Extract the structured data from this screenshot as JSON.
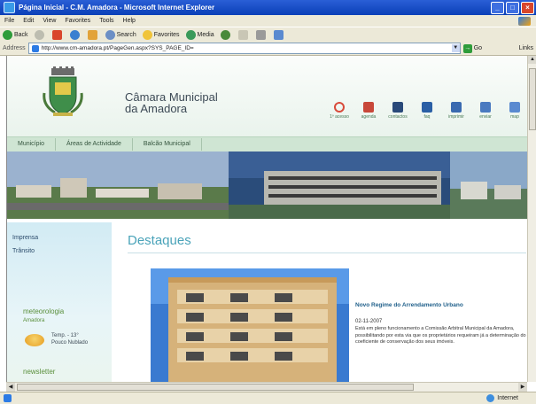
{
  "window": {
    "title": "Página Inicial - C.M. Amadora - Microsoft Internet Explorer",
    "minimize_label": "_",
    "maximize_label": "□",
    "close_label": "×"
  },
  "menubar": {
    "items": [
      "File",
      "Edit",
      "View",
      "Favorites",
      "Tools",
      "Help"
    ]
  },
  "toolbar": {
    "back_label": "Back",
    "search_label": "Search",
    "favorites_label": "Favorites",
    "media_label": "Media"
  },
  "address": {
    "label": "Address",
    "url": "http://www.cm-amadora.pt/PageGen.aspx?SYS_PAGE_ID=",
    "go_label": "Go",
    "links_label": "Links"
  },
  "site": {
    "brand_line1": "Câmara Municipal",
    "brand_line2": "da Amadora",
    "quick_links": [
      {
        "label": "1º acesso",
        "icon": "first-access-icon",
        "color": "#d84a3a"
      },
      {
        "label": "agenda",
        "icon": "agenda-icon",
        "color": "#c8483a"
      },
      {
        "label": "contactos",
        "icon": "contacts-icon",
        "color": "#2a4a7a"
      },
      {
        "label": "faq",
        "icon": "faq-icon",
        "color": "#2a5fa5"
      },
      {
        "label": "imprimir",
        "icon": "print-icon",
        "color": "#3a6ab0"
      },
      {
        "label": "enviar",
        "icon": "send-icon",
        "color": "#4a7ac0"
      },
      {
        "label": "map",
        "icon": "map-icon",
        "color": "#5a8ad0"
      }
    ],
    "nav": [
      "Município",
      "Áreas de Actividade",
      "Balcão Municipal"
    ],
    "sidebar_links": [
      "Imprensa",
      "Trânsito"
    ],
    "meteo": {
      "title": "meteorologia",
      "place": "Amadora",
      "temp": "Temp. - 13°",
      "condition": "Pouco Nublado"
    },
    "newsletter": "newsletter",
    "section_title": "Destaques",
    "news": {
      "headline": "Novo Regime do Arrendamento Urbano",
      "date": "02-11-2007",
      "body": "Está em pleno funcionamento a Comissão Arbitral Municipal da Amadora, possibilitando por esta via que os proprietários requeiram já a determinação do coeficiente de conservação dos seus imóveis."
    }
  },
  "status": {
    "text": "",
    "zone": "Internet"
  },
  "colors": {
    "title_blue": "#0a3fb7",
    "accent_teal": "#4aa3b9",
    "nav_green": "#cfe5d3",
    "meteo_green": "#5a8f3b"
  }
}
